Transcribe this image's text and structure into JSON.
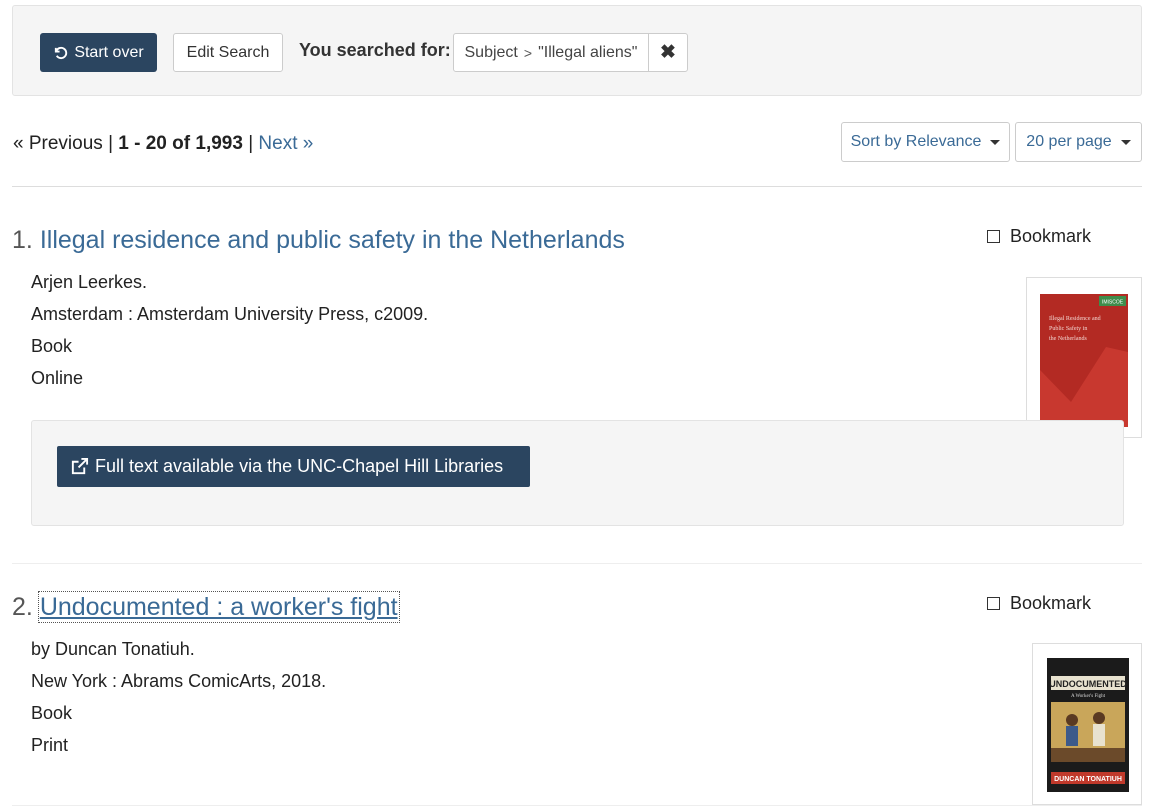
{
  "constraints": {
    "start_over_label": "Start over",
    "edit_search_label": "Edit Search",
    "you_searched_for": "You searched for:",
    "filter_field": "Subject",
    "filter_separator": ">",
    "filter_value": "\"Illegal aliens\"",
    "remove_symbol": "✖"
  },
  "pagination": {
    "previous": "« Previous",
    "separator": "|",
    "range": "1 - 20",
    "of": "of",
    "total": "1,993",
    "next": "Next »"
  },
  "sort": {
    "label": "Sort by Relevance"
  },
  "per_page": {
    "label": "20 per page"
  },
  "documents": [
    {
      "number": "1.",
      "title": "Illegal residence and public safety in the Netherlands",
      "author": "Arjen Leerkes.",
      "publisher": "Amsterdam : Amsterdam University Press, c2009.",
      "format": "Book",
      "location": "Online",
      "bookmark_label": "Bookmark",
      "fulltext_label": "Full text available via the UNC-Chapel Hill Libraries",
      "cover": {
        "publisher_tag": "IMISCOE",
        "text": "Illegal Residence and Public Safety in the Netherlands"
      }
    },
    {
      "number": "2.",
      "title": "Undocumented : a worker's fight",
      "author": "by Duncan Tonatiuh.",
      "publisher": "New York : Abrams ComicArts, 2018.",
      "format": "Book",
      "location": "Print",
      "bookmark_label": "Bookmark",
      "cover": {
        "title": "UNDOCUMENTED",
        "subtitle": "A Worker's Fight",
        "author": "DUNCAN TONATIUH"
      }
    }
  ],
  "colors": {
    "primary_button": "#2b4560",
    "link": "#3a6a96",
    "panel_bg": "#f5f5f5"
  }
}
